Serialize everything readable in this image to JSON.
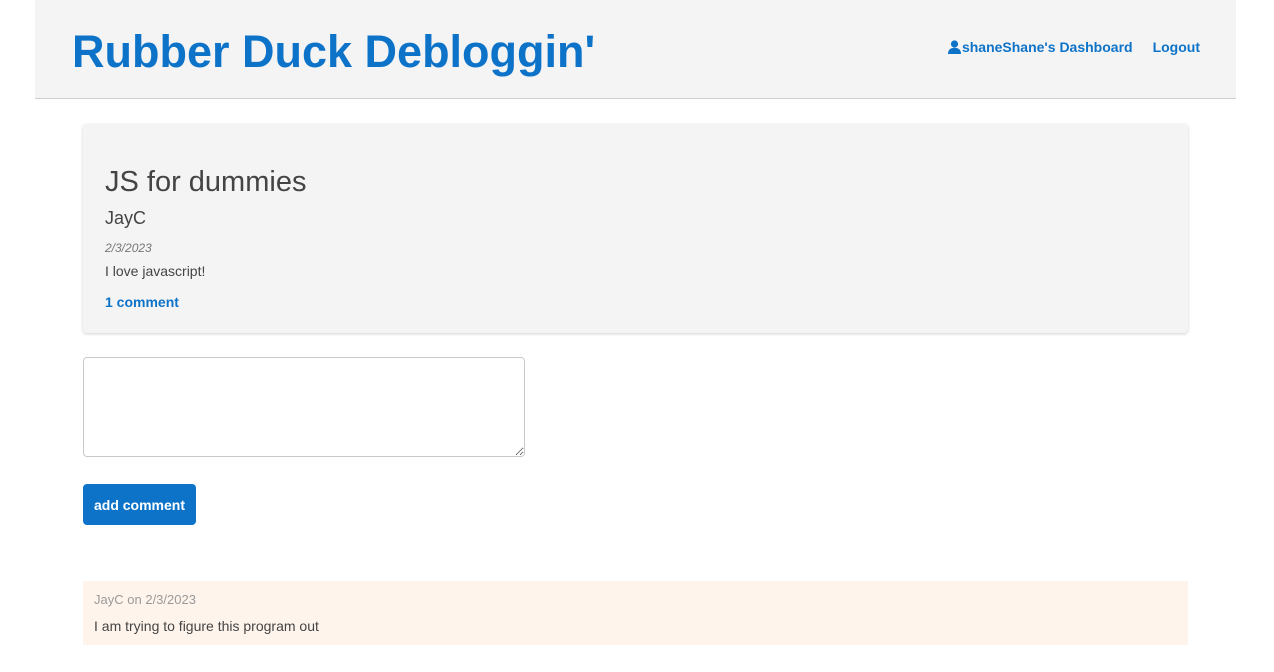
{
  "header": {
    "site_title": "Rubber Duck Debloggin'",
    "nav": {
      "username": "shane",
      "dashboard_label": "Shane's Dashboard",
      "logout_label": "Logout"
    },
    "user_icon": "user-icon"
  },
  "post": {
    "title": "JS for dummies",
    "author": "JayC",
    "date": "2/3/2023",
    "body": "I love javascript!",
    "comments_link": "1 comment"
  },
  "comment_form": {
    "textarea_value": "",
    "submit_label": "add comment"
  },
  "comments": [
    {
      "author": "JayC",
      "on": "on",
      "date": "2/3/2023",
      "text": "I am trying to figure this program out"
    }
  ],
  "colors": {
    "accent": "#0d73c9",
    "header_bg": "#f4f4f4",
    "card_bg": "#f4f4f4",
    "comment_bg": "#fff4ec"
  }
}
